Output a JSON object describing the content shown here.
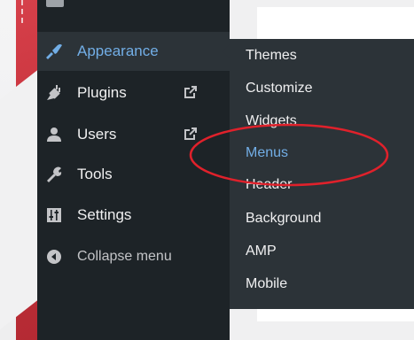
{
  "colors": {
    "sidebar_bg": "#1d2327",
    "submenu_bg": "#2c3338",
    "text": "#f0f0f1",
    "accent": "#72aee6",
    "annotation": "#e0212b"
  },
  "sidebar": {
    "items": [
      {
        "label": "Appearance",
        "icon": "paintbrush-icon",
        "current": true
      },
      {
        "label": "Plugins",
        "icon": "plugin-icon",
        "external": true
      },
      {
        "label": "Users",
        "icon": "users-icon",
        "external": true
      },
      {
        "label": "Tools",
        "icon": "wrench-icon"
      },
      {
        "label": "Settings",
        "icon": "settings-sliders-icon"
      },
      {
        "label": "Collapse menu",
        "icon": "collapse-arrow-icon"
      }
    ]
  },
  "submenu": {
    "items": [
      {
        "label": "Themes"
      },
      {
        "label": "Customize"
      },
      {
        "label": "Widgets"
      },
      {
        "label": "Menus",
        "active": true
      },
      {
        "label": "Header"
      },
      {
        "label": "Background"
      },
      {
        "label": "AMP"
      },
      {
        "label": "Mobile"
      }
    ]
  }
}
